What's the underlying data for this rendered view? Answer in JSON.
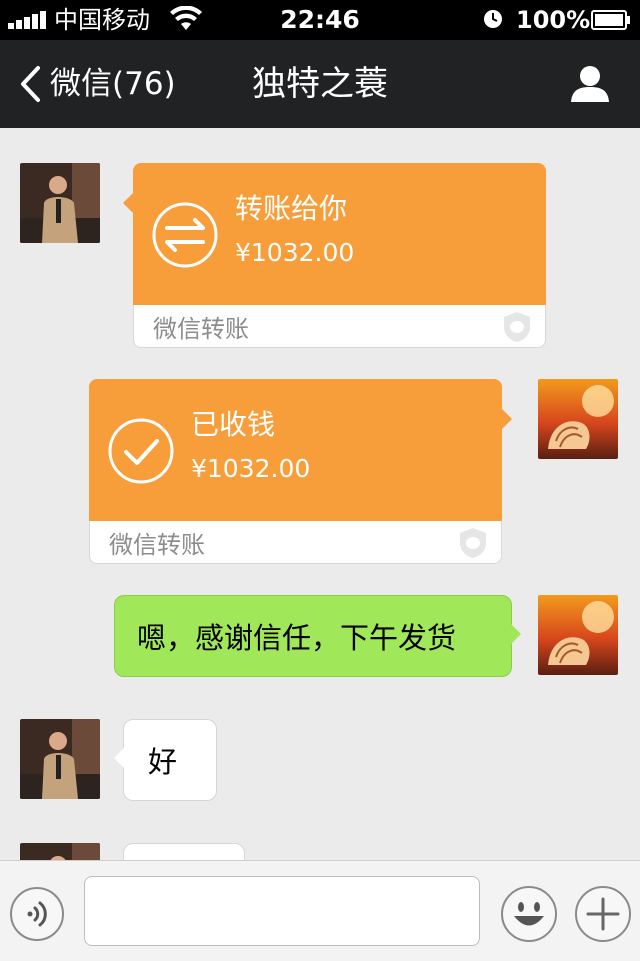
{
  "status_bar": {
    "carrier": "中国移动",
    "time": "22:46",
    "battery": "100%"
  },
  "nav": {
    "back_label": "微信(76)",
    "title": "独特之蓑"
  },
  "messages": [
    {
      "type": "transfer",
      "side": "left",
      "title": "转账给你",
      "amount": "¥1032.00",
      "footer": "微信转账",
      "icon": "transfer-arrows-icon"
    },
    {
      "type": "transfer",
      "side": "right",
      "title": "已收钱",
      "amount": "¥1032.00",
      "footer": "微信转账",
      "icon": "checkmark-icon"
    },
    {
      "type": "text",
      "side": "right",
      "text": "嗯，感谢信任，下午发货"
    },
    {
      "type": "text",
      "side": "left",
      "text": "好"
    },
    {
      "type": "text",
      "side": "left",
      "text": ""
    }
  ],
  "input": {
    "value": "",
    "placeholder": ""
  },
  "colors": {
    "transfer_orange": "#f79e3b",
    "sent_green": "#a0e75a",
    "nav_background": "#212224",
    "chat_background": "#ebebeb"
  }
}
